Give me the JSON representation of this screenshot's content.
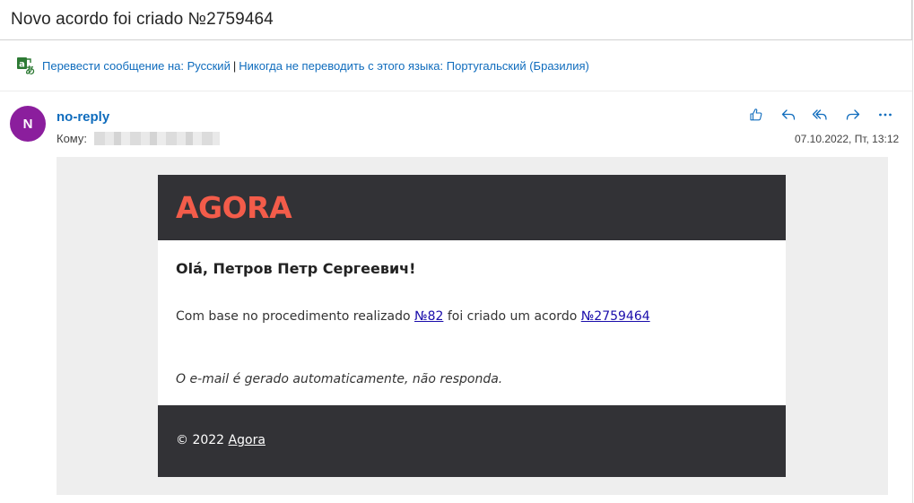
{
  "email": {
    "subject": "Novo acordo foi criado №2759464",
    "translate": {
      "link1": "Перевести сообщение на: Русский",
      "separator": "|",
      "link2": "Никогда не переводить с этого языка: Португальский (Бразилия)"
    },
    "sender": {
      "avatar_letter": "N",
      "avatar_color": "#8b1e9d",
      "name": "no-reply",
      "to_label": "Кому:"
    },
    "date": "07.10.2022, Пт, 13:12",
    "actions": [
      "like-icon",
      "reply-icon",
      "reply-all-icon",
      "forward-icon",
      "more-icon"
    ]
  },
  "message": {
    "logo_text": "AGORA",
    "logo_color": "#f35c4a",
    "greeting": "Olá, Петров Петр Сергеевич!",
    "line_prefix": "Com base no procedimento realizado",
    "procedure_link": "№82",
    "line_middle": "foi criado um acordo",
    "agreement_link": "№2759464",
    "note": "O e-mail é gerado automaticamente, não responda.",
    "footer_copy": "© 2022",
    "footer_link": "Agora"
  }
}
